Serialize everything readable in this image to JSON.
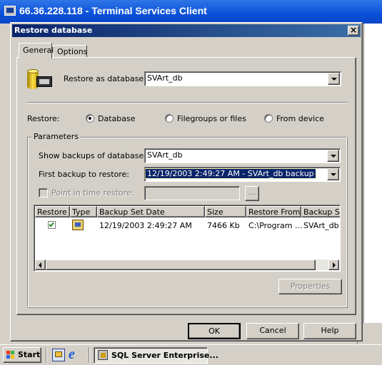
{
  "rdp": {
    "title": "66.36.228.118 - Terminal Services Client"
  },
  "dialog": {
    "title": "Restore database",
    "close_glyph": "×",
    "tabs": [
      {
        "label": "General"
      },
      {
        "label": "Options"
      }
    ],
    "restore_as_label": "Restore as database:",
    "restore_as_value": "SVArt_db",
    "restore_label": "Restore:",
    "restore_options": [
      {
        "label": "Database",
        "selected": true
      },
      {
        "label": "Filegroups or files",
        "selected": false
      },
      {
        "label": "From device",
        "selected": false
      }
    ],
    "parameters": {
      "legend": "Parameters",
      "show_backups_label": "Show backups of database:",
      "show_backups_value": "SVArt_db",
      "first_backup_label": "First backup to restore:",
      "first_backup_value": "12/19/2003 2:49:27 AM - SVArt_db backup",
      "point_in_time_label": "Point in time restore:",
      "browse_label": "..."
    },
    "table": {
      "columns": [
        "Restore",
        "Type",
        "Backup Set Date",
        "Size",
        "Restore From",
        "Backup Se"
      ],
      "rows": [
        {
          "date": "12/19/2003 2:49:27 AM",
          "size": "7466 Kb",
          "from": "C:\\Program ...",
          "set": "SVArt_db b"
        }
      ]
    },
    "properties_label": "Properties",
    "ok_label": "OK",
    "cancel_label": "Cancel",
    "help_label": "Help"
  },
  "taskbar": {
    "start_label": "Start",
    "task_label": "SQL Server Enterprise..."
  },
  "colors": {
    "title_active": "#0a246a",
    "rdp_blue": "#0054e3",
    "selection": "#0a246a"
  }
}
